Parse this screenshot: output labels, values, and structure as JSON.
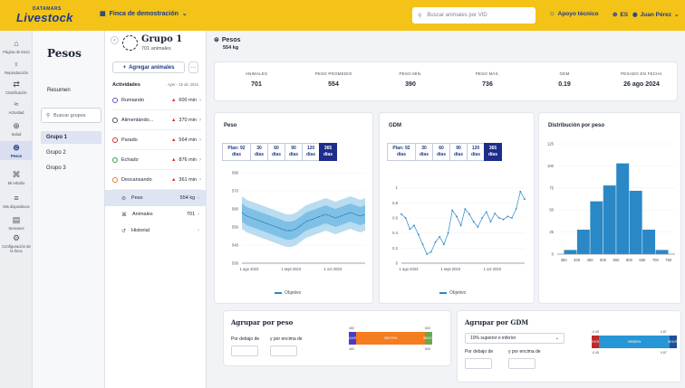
{
  "topbar": {
    "logo_small": "DATAMARS",
    "logo_big": "Livestock",
    "farm_name": "Finca de demostración",
    "search_placeholder": "Buscar animales por VID",
    "support": "Apoyo técnico",
    "lang": "ES",
    "user": "Juan Pérez"
  },
  "nav": [
    {
      "icon": "home-icon",
      "glyph": "⌂",
      "label": "Página de inicio"
    },
    {
      "icon": "reproduction-icon",
      "glyph": "♀",
      "label": "Reproducción"
    },
    {
      "icon": "classification-icon",
      "glyph": "⇄",
      "label": "Clasificación"
    },
    {
      "icon": "activity-icon",
      "glyph": "≈",
      "label": "Actividad"
    },
    {
      "icon": "health-icon",
      "glyph": "⊕",
      "label": "Salud"
    },
    {
      "icon": "weight-icon",
      "glyph": "⊜",
      "label": "Pesos",
      "active": true
    },
    {
      "icon": "herd-icon",
      "glyph": "⌘",
      "label": "Mi rebaño"
    },
    {
      "icon": "devices-icon",
      "glyph": "≡",
      "label": "Mis dispositivos"
    },
    {
      "icon": "sessions-icon",
      "glyph": "▤",
      "label": "Sesiones"
    },
    {
      "icon": "settings-icon",
      "glyph": "⚙",
      "label": "Configuración de la finca"
    }
  ],
  "groups_panel": {
    "title": "Pesos",
    "summary": "Resumen",
    "search_placeholder": "Buscar grupos",
    "groups": [
      "Grupo 1",
      "Grupo 2",
      "Grupo 3"
    ]
  },
  "group": {
    "name": "Grupo 1",
    "count": "701 animales",
    "add_animals": "Agregar animales",
    "more": "···",
    "activities_title": "Actividades",
    "activities_date": "Ayer - 15 dic 2024",
    "activities": [
      {
        "label": "Rumiando",
        "value": "600 min",
        "color": "#6b4fc8"
      },
      {
        "label": "Alimentándo...",
        "value": "370 min",
        "color": "#4a5160"
      },
      {
        "label": "Parado",
        "value": "564 min",
        "color": "#d2322d"
      },
      {
        "label": "Echado",
        "value": "876 min",
        "color": "#3aa04a"
      },
      {
        "label": "Descansando",
        "value": "361 min",
        "color": "#e07a2d"
      }
    ],
    "menu": [
      {
        "icon": "scale-icon",
        "glyph": "⊜",
        "label": "Peso",
        "value": "554 kg"
      },
      {
        "icon": "animals-icon",
        "glyph": "⌘",
        "label": "Animales",
        "value": "701"
      },
      {
        "icon": "history-icon",
        "glyph": "↺",
        "label": "Historial",
        "value": ""
      }
    ]
  },
  "main": {
    "title": "Pesos",
    "subtitle": "554 kg",
    "stats": [
      {
        "label": "ANIMALES",
        "value": "701"
      },
      {
        "label": "PESO PROMEDIO",
        "value": "554"
      },
      {
        "label": "PESO MÍN.",
        "value": "390"
      },
      {
        "label": "PESO MÁX.",
        "value": "736"
      },
      {
        "label": "GDM",
        "value": "0.19"
      },
      {
        "label": "PESADO EN FECHA",
        "value": "26 ago 2024"
      }
    ],
    "ranges": [
      "Plan: 92 días",
      "30 días",
      "60 días",
      "90 días",
      "120 días",
      "365 días"
    ],
    "legend_target": "Objetivo",
    "peso_title": "Peso",
    "gdm_title": "GDM",
    "dist_title": "Distribución por peso",
    "agrupar_peso": {
      "title": "Agrupar por peso",
      "below": "Por debajo de",
      "above": "y por encima de",
      "left_val": "34\n10%",
      "mid_val": "250\n79%",
      "right_val": "38\n11%",
      "t1": "460",
      "t2": "600",
      "b1": "460",
      "b2": "600"
    },
    "agrupar_gdm": {
      "title": "Agrupar por GDM",
      "select": "10% superior e inferior",
      "below": "Por debajo de",
      "above": "y por encima de",
      "left_val": "30\n10%",
      "mid_val": "290\n82%",
      "right_val": "30\n10%",
      "t1": "-0.45",
      "t2": "0.87",
      "b1": "-0.45",
      "b2": "0.87"
    }
  },
  "chart_data": [
    {
      "type": "line",
      "title": "Peso",
      "x_ticks": [
        "1 ago 2023",
        "1 sept 2023",
        "1 oct 2023"
      ],
      "ylim": [
        530,
        580
      ],
      "y_ticks": [
        530,
        540,
        550,
        560,
        570,
        580
      ],
      "series": [
        {
          "values": [
            558,
            556,
            555,
            554,
            553,
            552,
            551,
            550,
            549,
            548,
            548,
            549,
            551,
            553,
            554,
            555,
            556,
            557,
            556,
            555,
            556,
            557,
            558,
            557,
            556,
            557
          ]
        }
      ]
    },
    {
      "type": "line",
      "title": "GDM",
      "x_ticks": [
        "1 ago 2023",
        "1 sept 2023",
        "1 oct 2023"
      ],
      "ylim": [
        0,
        1.2
      ],
      "y_ticks": [
        0,
        0.2,
        0.4,
        0.6,
        0.8,
        1
      ],
      "series": [
        {
          "values": [
            0.65,
            0.6,
            0.45,
            0.5,
            0.38,
            0.25,
            0.12,
            0.15,
            0.28,
            0.35,
            0.25,
            0.4,
            0.7,
            0.62,
            0.5,
            0.72,
            0.65,
            0.55,
            0.48,
            0.6,
            0.68,
            0.55,
            0.66,
            0.6,
            0.58,
            0.62,
            0.6,
            0.72,
            0.95,
            0.85
          ]
        }
      ]
    },
    {
      "type": "bar",
      "title": "Distribución por peso",
      "categories": [
        "350",
        "400",
        "450",
        "500",
        "550",
        "600",
        "650",
        "700",
        "750"
      ],
      "values": [
        5,
        28,
        60,
        78,
        103,
        72,
        28,
        5,
        0
      ],
      "ylim": [
        0,
        125
      ],
      "y_ticks": [
        0,
        25,
        50,
        75,
        100,
        125
      ]
    }
  ]
}
